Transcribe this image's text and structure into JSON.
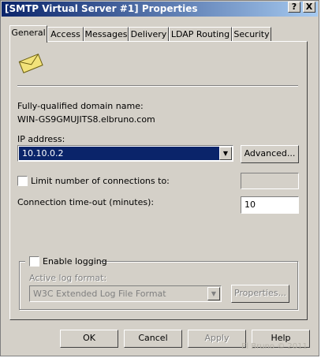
{
  "window": {
    "title": "[SMTP Virtual Server #1] Properties",
    "help_glyph": "?",
    "close_glyph": "X"
  },
  "tabs": [
    {
      "label": "General"
    },
    {
      "label": "Access"
    },
    {
      "label": "Messages"
    },
    {
      "label": "Delivery"
    },
    {
      "label": "LDAP Routing"
    },
    {
      "label": "Security"
    }
  ],
  "general": {
    "fqdn_label": "Fully-qualified domain name:",
    "fqdn_value": "WIN-GS9GMUJITS8.elbruno.com",
    "ip_label": "IP address:",
    "ip_value": "10.10.0.2",
    "advanced_button": "Advanced...",
    "limit_connections_label": "Limit number of connections to:",
    "limit_connections_checked": false,
    "timeout_label": "Connection time-out (minutes):",
    "timeout_value": "10",
    "enable_logging_label": "Enable logging",
    "enable_logging_checked": false,
    "log_format_label": "Active log format:",
    "log_format_value": "W3C Extended Log File Format",
    "properties_button": "Properties..."
  },
  "footer": {
    "ok": "OK",
    "cancel": "Cancel",
    "apply": "Apply",
    "help": "Help"
  },
  "watermark": "El Bruno © 2011",
  "icon": {
    "name": "envelope-icon",
    "color": "#f2e27a"
  }
}
